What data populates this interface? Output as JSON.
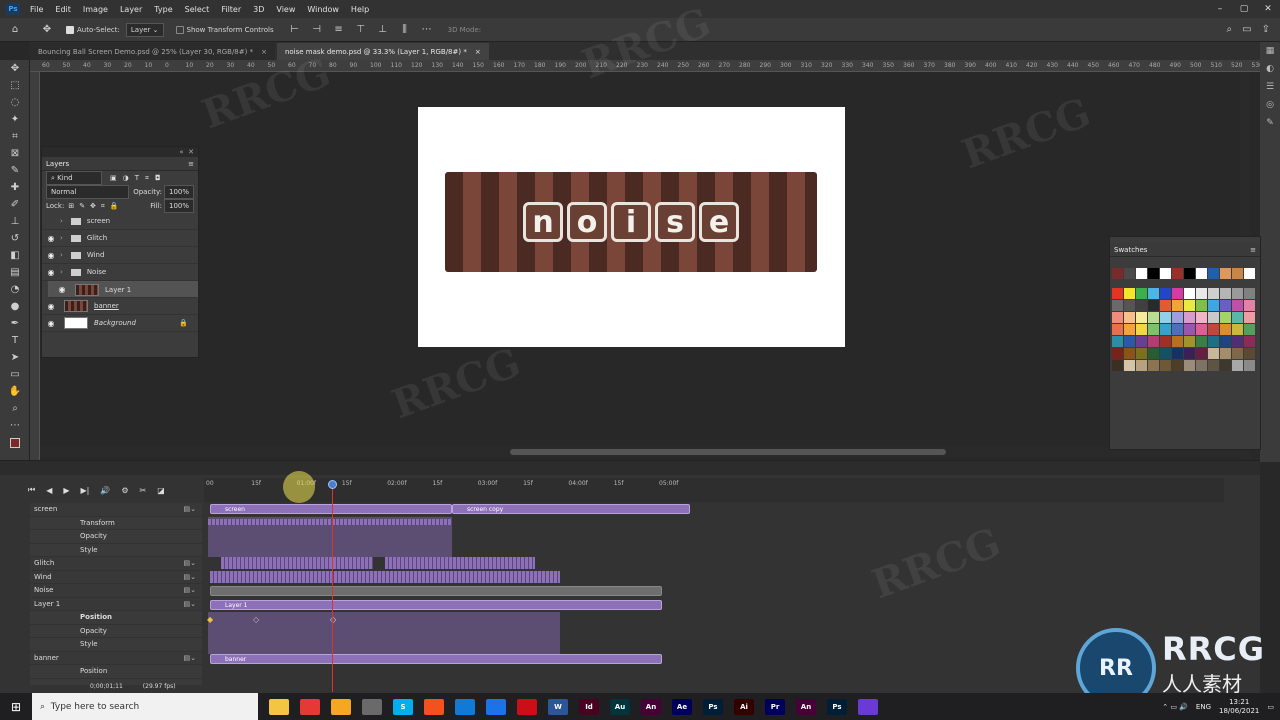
{
  "menu": [
    "File",
    "Edit",
    "Image",
    "Layer",
    "Type",
    "Select",
    "Filter",
    "3D",
    "View",
    "Window",
    "Help"
  ],
  "app_badge": "Ps",
  "options": {
    "auto_select_label": "Auto-Select:",
    "auto_select_value": "Layer",
    "transform_label": "Show Transform Controls",
    "mode_label": "3D Mode:"
  },
  "tabs": [
    {
      "label": "Bouncing Ball Screen Demo.psd @ 25% (Layer 30, RGB/8#) *",
      "close": "×"
    },
    {
      "label": "noise mask demo.psd @ 33.3% (Layer 1, RGB/8#) *",
      "close": "×"
    }
  ],
  "ruler_labels": [
    "60",
    "50",
    "40",
    "30",
    "20",
    "10",
    "0",
    "10",
    "20",
    "30",
    "40",
    "50",
    "60",
    "70",
    "80",
    "90",
    "100",
    "110",
    "120",
    "130",
    "140",
    "150",
    "160",
    "170",
    "180",
    "190",
    "200",
    "210",
    "220",
    "230",
    "240",
    "250",
    "260",
    "270",
    "280",
    "290",
    "300",
    "310",
    "320",
    "330",
    "340",
    "350",
    "360",
    "370",
    "380",
    "390",
    "400",
    "410",
    "420",
    "430",
    "440",
    "450",
    "460",
    "470",
    "480",
    "490",
    "500",
    "510",
    "520",
    "530"
  ],
  "canvas": {
    "letters": [
      "n",
      "o",
      "i",
      "s",
      "e"
    ]
  },
  "layers_panel": {
    "title": "Layers",
    "filter": "Kind",
    "blend": "Normal",
    "opacity_label": "Opacity:",
    "opacity": "100%",
    "lock_label": "Lock:",
    "fill_label": "Fill:",
    "fill": "100%",
    "items": [
      {
        "name": "screen",
        "type": "group",
        "visible": false
      },
      {
        "name": "Glitch",
        "type": "group",
        "visible": true
      },
      {
        "name": "Wind",
        "type": "group",
        "visible": true
      },
      {
        "name": "Noise",
        "type": "group",
        "visible": true
      },
      {
        "name": "Layer 1",
        "type": "layer",
        "visible": true
      },
      {
        "name": "banner",
        "type": "layer",
        "visible": true
      },
      {
        "name": "Background",
        "type": "layer",
        "visible": true
      }
    ]
  },
  "swatches": {
    "title": "Swatches",
    "top_row": [
      "#7a2a28",
      "#4a4a4a",
      "#ffffff",
      "#000000",
      "#ffffff",
      "#9a3028",
      "#000000",
      "#ffffff",
      "#1e5fae",
      "#e0975a",
      "#c8864a",
      "#ffffff"
    ],
    "grid": [
      "#e23524",
      "#f2e52a",
      "#3cb04a",
      "#4fb4e6",
      "#2346c7",
      "#d63aa4",
      "#ffffff",
      "#e8e8e8",
      "#cfcfcf",
      "#b5b5b5",
      "#9a9a9a",
      "#808080",
      "#6a6a6a",
      "#555555",
      "#404040",
      "#2a2a2a",
      "#e55a2f",
      "#f2a531",
      "#eaea44",
      "#7fc04a",
      "#3ca7e2",
      "#6a5ec9",
      "#c14fa8",
      "#e87fa6",
      "#f28b7b",
      "#f7c08a",
      "#f7ea98",
      "#b8dc94",
      "#8fd0ea",
      "#9c9ee0",
      "#d99ad0",
      "#f2b4c6",
      "#c9c9c9",
      "#a3d46a",
      "#58b8a8",
      "#f09aa2",
      "#e66f4c",
      "#f4a23c",
      "#f2d73d",
      "#7cc26a",
      "#35a3c9",
      "#4e6fbd",
      "#9a56ad",
      "#de5d94",
      "#c4453e",
      "#db8e2b",
      "#c9b93a",
      "#52a05a",
      "#2a8fa6",
      "#2a5aa6",
      "#6c3e91",
      "#b33c72",
      "#a03025",
      "#b67020",
      "#a0932a",
      "#3a7d45",
      "#1c6f86",
      "#1f4482",
      "#512d73",
      "#8a2b58",
      "#7a2219",
      "#8a5418",
      "#7a701e",
      "#2a5c33",
      "#135262",
      "#163260",
      "#3a2055",
      "#661f41",
      "#c9b79a",
      "#a38d6a",
      "#7d6848",
      "#5a4a32",
      "#3a2f22",
      "#d4c4a8",
      "#b8a27e",
      "#8c7450",
      "#6e583a",
      "#4e3e28",
      "#9a8c78",
      "#7e7262",
      "#5e5446",
      "#3e372e",
      "#a8a8a8",
      "#8a8a8a"
    ]
  },
  "timeline": {
    "ruler": [
      "00",
      "15f",
      "01:00f",
      "15f",
      "02:00f",
      "15f",
      "03:00f",
      "15f",
      "04:00f",
      "15f",
      "05:00f"
    ],
    "tracks": [
      {
        "label": "screen",
        "kind": "group"
      },
      {
        "label": "Transform",
        "kind": "sub"
      },
      {
        "label": "Opacity",
        "kind": "sub"
      },
      {
        "label": "Style",
        "kind": "sub"
      },
      {
        "label": "Glitch",
        "kind": "group"
      },
      {
        "label": "Wind",
        "kind": "group"
      },
      {
        "label": "Noise",
        "kind": "group"
      },
      {
        "label": "Layer 1",
        "kind": "group"
      },
      {
        "label": "Position",
        "kind": "sub-bold"
      },
      {
        "label": "Opacity",
        "kind": "sub"
      },
      {
        "label": "Style",
        "kind": "sub"
      },
      {
        "label": "banner",
        "kind": "group"
      },
      {
        "label": "Position",
        "kind": "sub"
      }
    ],
    "clips": {
      "screen": "screen",
      "screen_copy": "screen copy",
      "layer1": "Layer 1",
      "banner": "banner"
    },
    "timecode": "0;00;01;11",
    "fps": "(29.97 fps)"
  },
  "taskbar": {
    "search_placeholder": "Type here to search",
    "apps": [
      {
        "label": "",
        "color": "#f4c542"
      },
      {
        "label": "",
        "color": "#e53935"
      },
      {
        "label": "",
        "color": "#f5a623"
      },
      {
        "label": "",
        "color": "#6a6a6a"
      },
      {
        "label": "S",
        "color": "#00aff0"
      },
      {
        "label": "",
        "color": "#f4511e"
      },
      {
        "label": "",
        "color": "#0f7bd7"
      },
      {
        "label": "",
        "color": "#1a73e8"
      },
      {
        "label": "",
        "color": "#cc0f16"
      },
      {
        "label": "W",
        "color": "#2b579a"
      },
      {
        "label": "Id",
        "color": "#49021f"
      },
      {
        "label": "Au",
        "color": "#00353b"
      },
      {
        "label": "An",
        "color": "#470137"
      },
      {
        "label": "Ae",
        "color": "#00005b"
      },
      {
        "label": "Ps",
        "color": "#001e36"
      },
      {
        "label": "Ai",
        "color": "#330000"
      },
      {
        "label": "Pr",
        "color": "#00005b"
      },
      {
        "label": "An",
        "color": "#470137"
      },
      {
        "label": "Ps",
        "color": "#001e36"
      },
      {
        "label": "",
        "color": "#6a3ad6"
      }
    ],
    "lang": "ENG",
    "time": "13:21",
    "date": "18/06/2021"
  },
  "watermark": {
    "logo_letters": "RR",
    "brand": "RRCG",
    "brand_cn": "人人素材"
  }
}
